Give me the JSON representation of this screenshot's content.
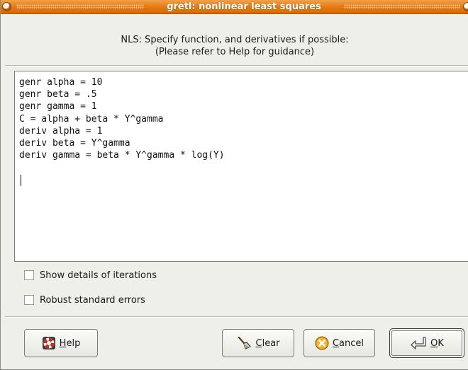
{
  "window": {
    "title": "gretl: nonlinear least squares"
  },
  "header": {
    "line1": "NLS: Specify function, and derivatives if possible:",
    "line2": "(Please refer to Help for guidance)"
  },
  "editor": {
    "lines": [
      "genr alpha = 10",
      "genr beta = .5",
      "genr gamma = 1",
      "C = alpha + beta * Y^gamma",
      "deriv alpha = 1",
      "deriv beta = Y^gamma",
      "deriv gamma = beta * Y^gamma * log(Y)"
    ]
  },
  "options": {
    "show_iterations": {
      "label": "Show details of iterations",
      "checked": false
    },
    "robust_errors": {
      "label": "Robust standard errors",
      "checked": false
    }
  },
  "buttons": {
    "help": {
      "mnemonic": "H",
      "rest": "elp",
      "icon": "lifebuoy-icon"
    },
    "clear": {
      "mnemonic": "C",
      "rest": "lear",
      "icon": "broom-icon"
    },
    "cancel": {
      "mnemonic": "C",
      "rest": "ancel",
      "icon": "cancel-icon"
    },
    "ok": {
      "mnemonic": "O",
      "rest": "K",
      "icon": "return-arrow-icon"
    }
  }
}
